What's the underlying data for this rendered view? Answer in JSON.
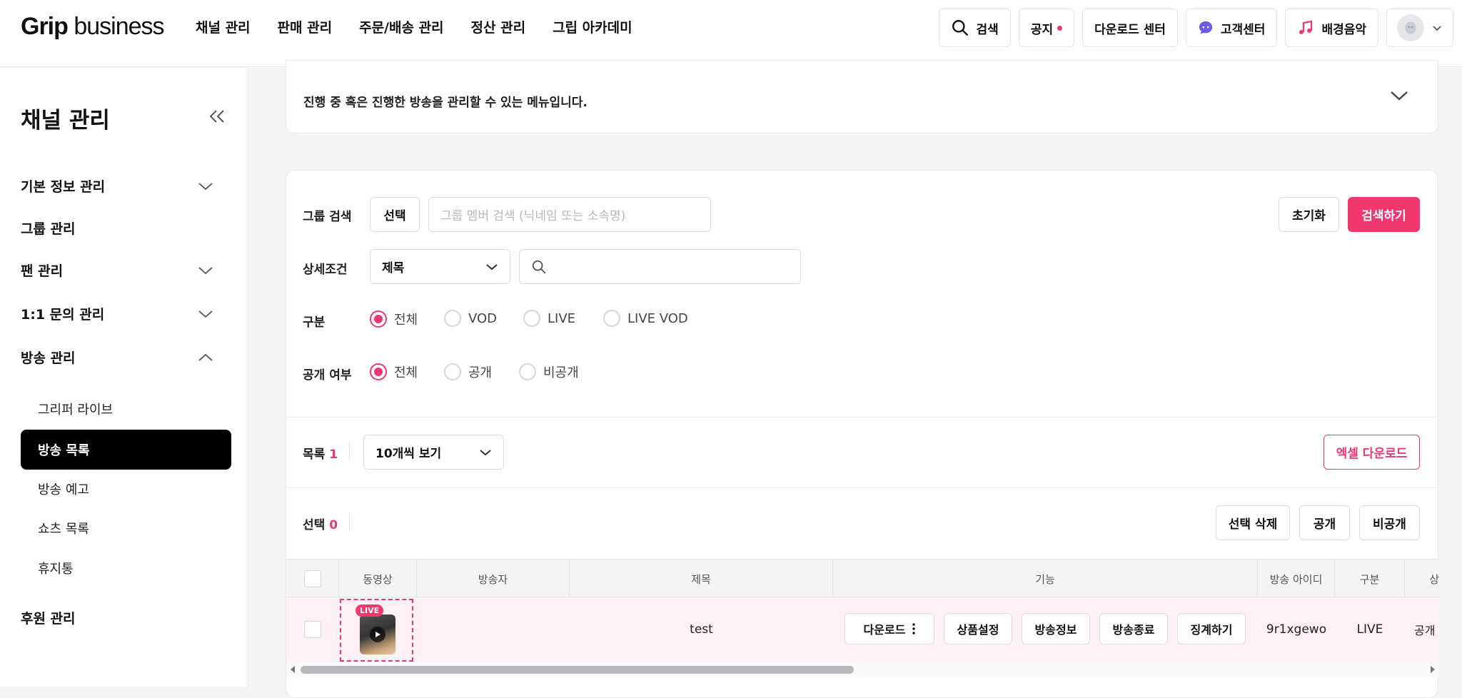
{
  "brand": {
    "bold": "Grip",
    "rest": " business"
  },
  "nav": [
    "채널 관리",
    "판매 관리",
    "주문/배송 관리",
    "정산 관리",
    "그립 아카데미"
  ],
  "tools": {
    "search": "검색",
    "notice": "공지",
    "download": "다운로드 센터",
    "support": "고객센터",
    "music": "배경음악"
  },
  "sidebar": {
    "title": "채널 관리",
    "items": [
      "기본 정보 관리",
      "그룹 관리",
      "팬 관리",
      "1:1 문의 관리",
      "방송 관리",
      "후원 관리"
    ],
    "subitems": [
      "그리퍼 라이브",
      "방송 목록",
      "방송 예고",
      "쇼츠 목록",
      "휴지통"
    ]
  },
  "info": {
    "text": "진행 중 혹은 진행한 방송을 관리할 수 있는 메뉴입니다."
  },
  "filters": {
    "group_label": "그룹 검색",
    "group_select": "선택",
    "group_placeholder": "그룹 멤버 검색 (닉네임 또는 소속명)",
    "reset": "초기화",
    "search": "검색하기",
    "detail_label": "상세조건",
    "detail_value": "제목",
    "type_label": "구분",
    "type_options": [
      "전체",
      "VOD",
      "LIVE",
      "LIVE VOD"
    ],
    "public_label": "공개 여부",
    "public_options": [
      "전체",
      "공개",
      "비공개"
    ]
  },
  "list": {
    "label": "목록",
    "count": "1",
    "page_size": "10개씩 보기",
    "excel": "엑셀 다운로드",
    "selected_label": "선택",
    "selected_count": "0",
    "delete": "선택 삭제",
    "public": "공개",
    "private": "비공개"
  },
  "table": {
    "headers": [
      "동영상",
      "방송자",
      "제목",
      "기능",
      "방송 아이디",
      "구분",
      "상"
    ],
    "row": {
      "badge": "LIVE",
      "title": "test",
      "actions": [
        "다운로드",
        "상품설정",
        "방송정보",
        "방송종료",
        "징계하기"
      ],
      "broadcast_id": "9r1xgewo",
      "type": "LIVE",
      "status": "공개"
    }
  },
  "colors": {
    "accent": "#f0386e"
  }
}
